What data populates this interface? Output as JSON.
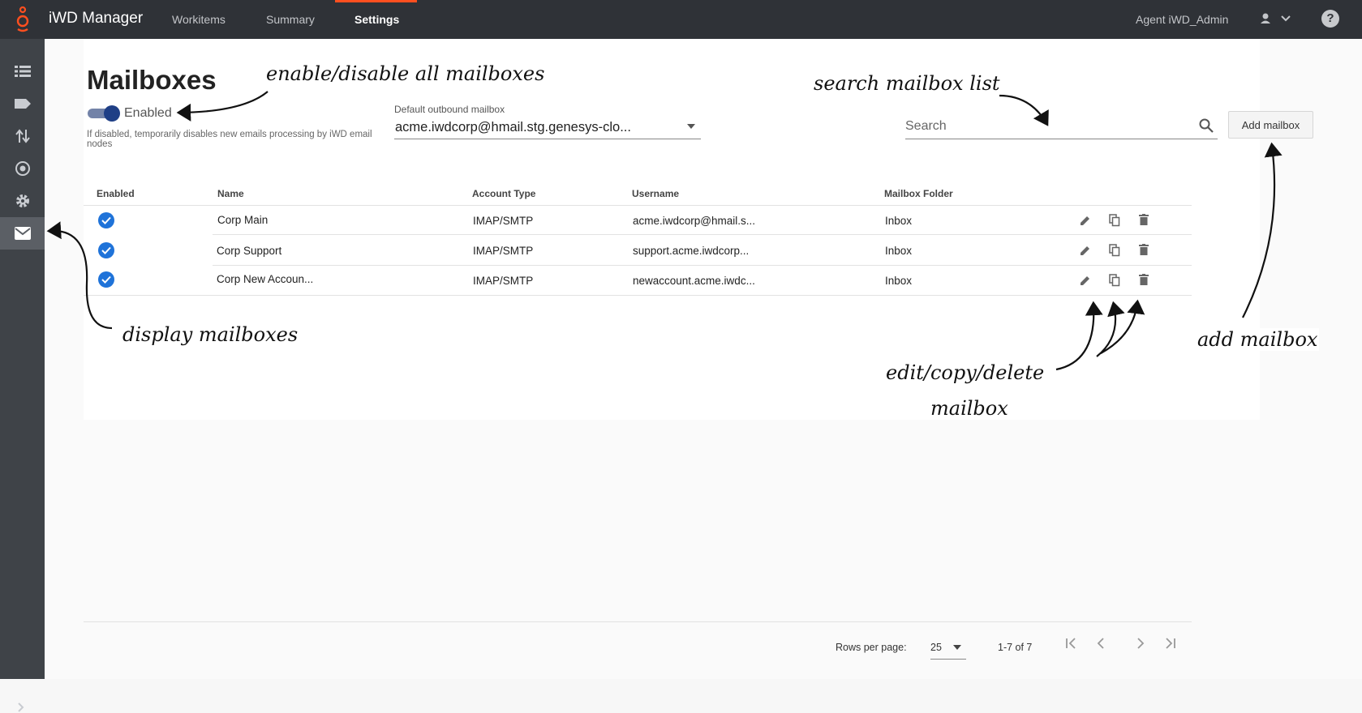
{
  "topbar": {
    "app_title": "iWD Manager",
    "tabs": [
      "Workitems",
      "Summary",
      "Settings"
    ],
    "active_tab": "Settings",
    "agent": "Agent iWD_Admin",
    "help": "?"
  },
  "sidebar": {
    "items": [
      "list-icon",
      "tag-icon",
      "transfer-icon",
      "target-icon",
      "gear-icon",
      "mail-icon"
    ],
    "active": "mail-icon"
  },
  "page": {
    "title": "Mailboxes",
    "toggle_label": "Enabled",
    "toggle_on": true,
    "hint": "If disabled, temporarily disables new emails processing by iWD email nodes",
    "dropdown_label": "Default outbound mailbox",
    "dropdown_value": "acme.iwdcorp@hmail.stg.genesys-clo...",
    "search_placeholder": "Search",
    "add_button": "Add mailbox"
  },
  "table": {
    "headers": [
      "Enabled",
      "Name",
      "Account Type",
      "Username",
      "Mailbox Folder"
    ],
    "rows": [
      {
        "name": "Corp Main",
        "type": "IMAP/SMTP",
        "username": "acme.iwdcorp@hmail.s...",
        "folder": "Inbox"
      },
      {
        "name": "Corp Support",
        "type": "IMAP/SMTP",
        "username": "support.acme.iwdcorp...",
        "folder": "Inbox"
      },
      {
        "name": "Corp New Accoun...",
        "type": "IMAP/SMTP",
        "username": "newaccount.acme.iwdc...",
        "folder": "Inbox"
      }
    ]
  },
  "pagination": {
    "rows_label": "Rows per page:",
    "rows_value": "25",
    "range": "1-7 of 7"
  },
  "annotations": {
    "toggle": "enable/disable all mailboxes",
    "search": "search mailbox list",
    "display": "display mailboxes",
    "actions_line1": "edit/copy/delete",
    "actions_line2": "mailbox",
    "add": "add mailbox"
  }
}
